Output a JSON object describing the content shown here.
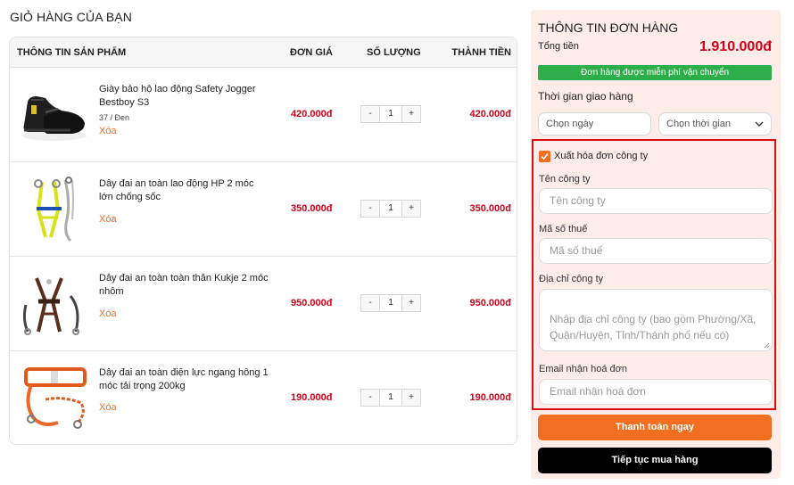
{
  "page_title": "GIỎ HÀNG CỦA BẠN",
  "cart": {
    "headers": {
      "product": "THÔNG TIN SẢN PHẨM",
      "price": "ĐƠN GIÁ",
      "quantity": "SỐ LƯỢNG",
      "total": "THÀNH TIỀN"
    },
    "minus_label": "-",
    "plus_label": "+",
    "items": [
      {
        "name": "Giày bảo hộ lao động Safety Jogger Bestboy S3",
        "variant": "37 / Đen",
        "remove": "Xóa",
        "price": "420.000đ",
        "quantity": "1",
        "total": "420.000đ"
      },
      {
        "name": "Dây đai an toàn lao động HP 2 móc lớn chống sốc",
        "remove": "Xóa",
        "price": "350.000đ",
        "quantity": "1",
        "total": "350.000đ"
      },
      {
        "name": "Dây đai an toàn toàn thân Kukje 2 móc nhôm",
        "remove": "Xóa",
        "price": "950.000đ",
        "quantity": "1",
        "total": "950.000đ"
      },
      {
        "name": "Dây đai an toàn điện lực ngang hông 1 móc tải trọng 200kg",
        "remove": "Xóa",
        "price": "190.000đ",
        "quantity": "1",
        "total": "190.000đ"
      }
    ]
  },
  "order": {
    "title": "THÔNG TIN ĐƠN HÀNG",
    "total_label": "Tổng tiền",
    "total_value": "1.910.000đ",
    "free_shipping": "Đơn hàng được miễn phí vận chuyển",
    "delivery_label": "Thời gian giao hàng",
    "date_select": "Chọn ngày",
    "time_select": "Chọn thời gian",
    "invoice": {
      "checkbox_label": "Xuất hóa đơn công ty",
      "checked": true,
      "company_label": "Tên công ty",
      "company_placeholder": "Tên công ty",
      "tax_label": "Mã số thuế",
      "tax_placeholder": "Mã số thuế",
      "address_label": "Địa chỉ công ty",
      "address_placeholder": "Nhập địa chỉ công ty (bao gồm Phường/Xã, Quận/Huyện, Tỉnh/Thành phố nếu có)",
      "email_label": "Email nhận hoá đơn",
      "email_placeholder": "Email nhận hoá đơn"
    },
    "pay_button": "Thanh toán ngay",
    "continue_button": "Tiếp tục mua hàng"
  },
  "colors": {
    "accent_orange": "#f26f21",
    "price_red": "#d0021b",
    "free_green": "#2eae4b",
    "panel_bg": "#fdece8",
    "highlight_border": "#d80f16"
  }
}
